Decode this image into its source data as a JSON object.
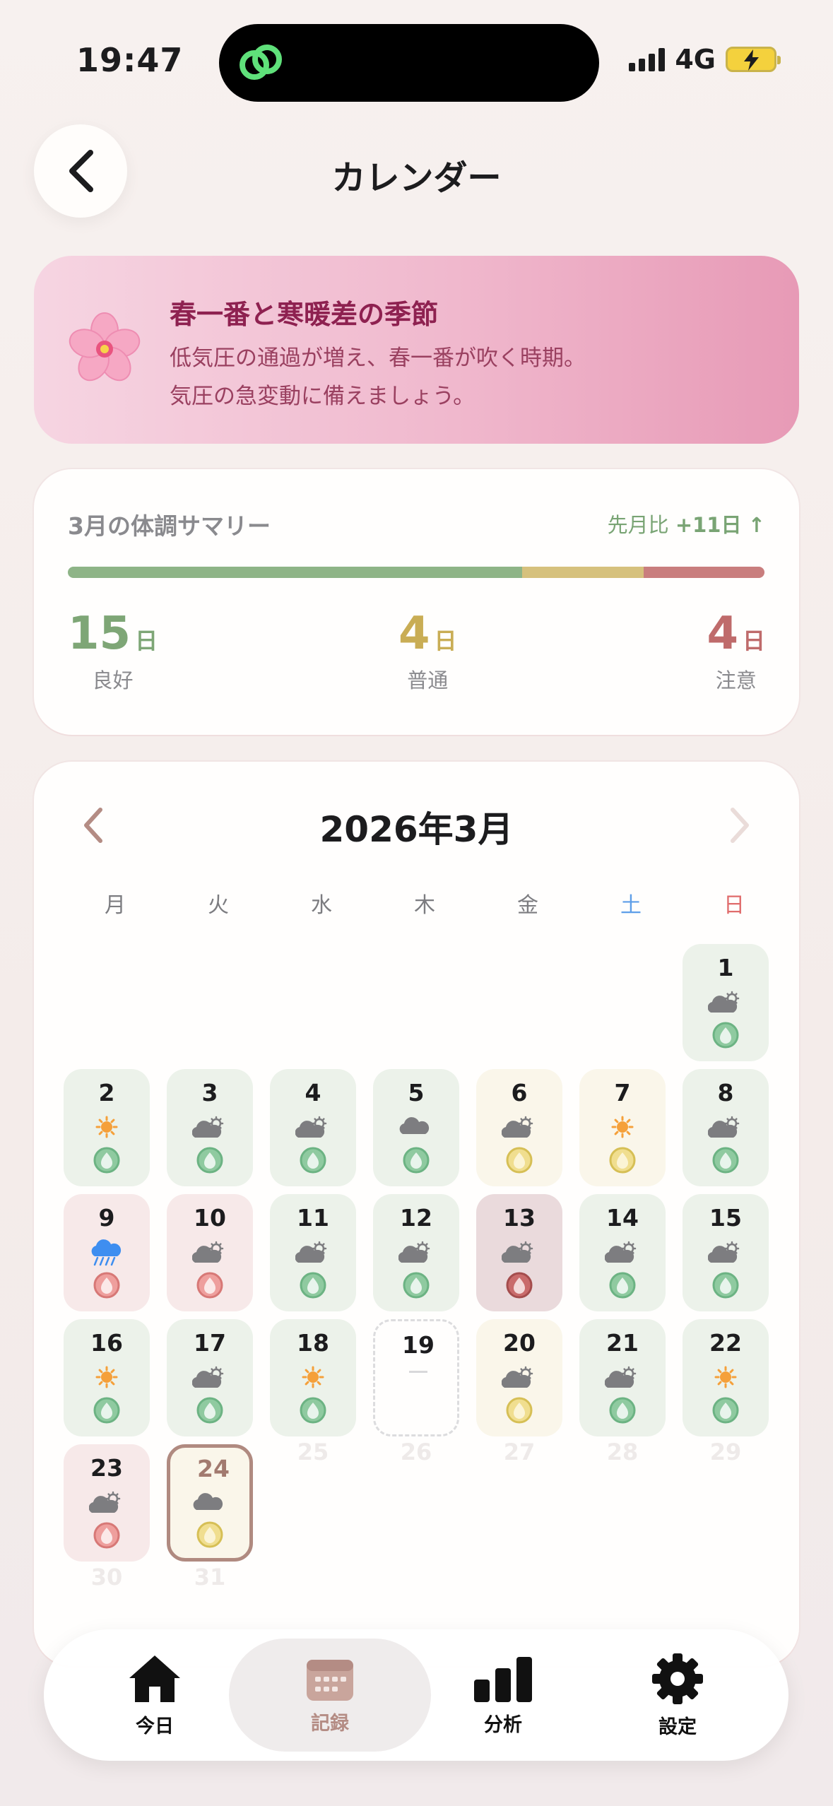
{
  "status_bar": {
    "time": "19:47",
    "network": "4G"
  },
  "header": {
    "title": "カレンダー"
  },
  "banner": {
    "title": "春一番と寒暖差の季節",
    "line1": "低気圧の通過が増え、春一番が吹く時期。",
    "line2": "気圧の急変動に備えましょう。"
  },
  "summary": {
    "title": "3月の体調サマリー",
    "compare_label": "先月比",
    "compare_value": "+11日",
    "compare_arrow": "↑",
    "good": {
      "count": "15",
      "unit": "日",
      "label": "良好"
    },
    "normal": {
      "count": "4",
      "unit": "日",
      "label": "普通"
    },
    "caution": {
      "count": "4",
      "unit": "日",
      "label": "注意"
    },
    "bar_colors": {
      "good": "#8eb487",
      "normal": "#d6c17d",
      "caution": "#c97e7e"
    }
  },
  "calendar": {
    "month_title": "2026年3月",
    "weekdays": [
      "月",
      "火",
      "水",
      "木",
      "金",
      "土",
      "日"
    ],
    "days": [
      {
        "day": "1",
        "weather": "partly-cloudy-icon",
        "mood": "good"
      },
      {
        "day": "2",
        "weather": "sun-icon",
        "mood": "good"
      },
      {
        "day": "3",
        "weather": "partly-cloudy-icon",
        "mood": "good"
      },
      {
        "day": "4",
        "weather": "partly-cloudy-icon",
        "mood": "good"
      },
      {
        "day": "5",
        "weather": "cloud-icon",
        "mood": "good"
      },
      {
        "day": "6",
        "weather": "partly-cloudy-icon",
        "mood": "normal"
      },
      {
        "day": "7",
        "weather": "sun-icon",
        "mood": "normal"
      },
      {
        "day": "8",
        "weather": "partly-cloudy-icon",
        "mood": "good"
      },
      {
        "day": "9",
        "weather": "rain-icon",
        "mood": "caution"
      },
      {
        "day": "10",
        "weather": "partly-cloudy-icon",
        "mood": "caution"
      },
      {
        "day": "11",
        "weather": "partly-cloudy-icon",
        "mood": "good"
      },
      {
        "day": "12",
        "weather": "partly-cloudy-icon",
        "mood": "good"
      },
      {
        "day": "13",
        "weather": "partly-cloudy-icon",
        "mood": "bad"
      },
      {
        "day": "14",
        "weather": "partly-cloudy-icon",
        "mood": "good"
      },
      {
        "day": "15",
        "weather": "partly-cloudy-icon",
        "mood": "good"
      },
      {
        "day": "16",
        "weather": "sun-icon",
        "mood": "good"
      },
      {
        "day": "17",
        "weather": "partly-cloudy-icon",
        "mood": "good"
      },
      {
        "day": "18",
        "weather": "sun-icon",
        "mood": "good"
      },
      {
        "day": "19",
        "weather": "none",
        "mood": "empty",
        "placeholder": "—"
      },
      {
        "day": "20",
        "weather": "partly-cloudy-icon",
        "mood": "normal"
      },
      {
        "day": "21",
        "weather": "partly-cloudy-icon",
        "mood": "good"
      },
      {
        "day": "22",
        "weather": "sun-icon",
        "mood": "good"
      },
      {
        "day": "23",
        "weather": "partly-cloudy-icon",
        "mood": "caution"
      },
      {
        "day": "24",
        "weather": "cloud-icon",
        "mood": "normal",
        "today": true
      },
      {
        "day": "25",
        "future": true
      },
      {
        "day": "26",
        "future": true
      },
      {
        "day": "27",
        "future": true
      },
      {
        "day": "28",
        "future": true
      },
      {
        "day": "29",
        "future": true
      },
      {
        "day": "30",
        "future": true
      },
      {
        "day": "31",
        "future": true
      }
    ]
  },
  "tabbar": {
    "today": "今日",
    "records": "記録",
    "analysis": "分析",
    "settings": "設定",
    "active": "records"
  }
}
